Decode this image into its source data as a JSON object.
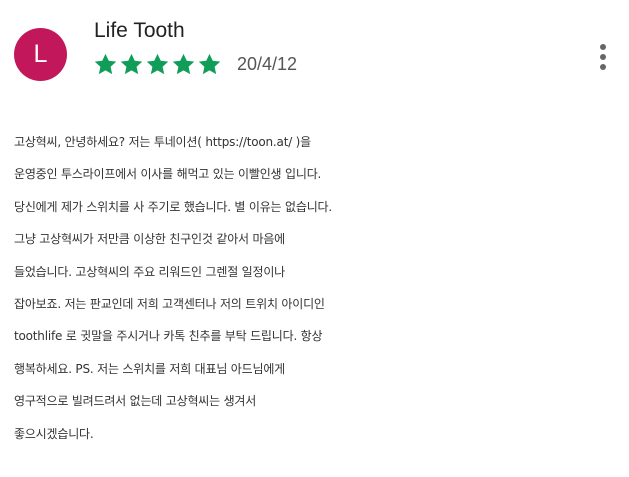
{
  "review": {
    "author_initial": "L",
    "author_name": "Life Tooth",
    "rating": 5,
    "rating_max": 5,
    "date": "20/4/12",
    "colors": {
      "avatar": "#c2185b",
      "star": "#0f9d58"
    },
    "icons": {
      "stars": "star-icon",
      "menu": "more-vert-icon"
    },
    "body_lines": [
      "고상혁씨, 안녕하세요? 저는 투네이션( https://toon.at/ )을",
      "운영중인 투스라이프에서 이사를 해먹고 있는 이빨인생 입니다.",
      "당신에게 제가 스위치를 사 주기로 했습니다. 별 이유는 없습니다.",
      "그냥 고상혁씨가 저만큼 이상한 친구인것 같아서 마음에",
      "들었습니다. 고상혁씨의 주요 리워드인 그렌절 일정이나",
      "잡아보죠. 저는 판교인데 저희 고객센터나 저의 트위치 아이디인",
      "toothlife 로 귓말을 주시거나 카톡 친추를 부탁 드립니다. 항상",
      "행복하세요. PS. 저는 스위치를 저희 대표님 아드님에게",
      "영구적으로 빌려드려서 없는데 고상혁씨는 생겨서",
      "좋으시겠습니다."
    ]
  }
}
